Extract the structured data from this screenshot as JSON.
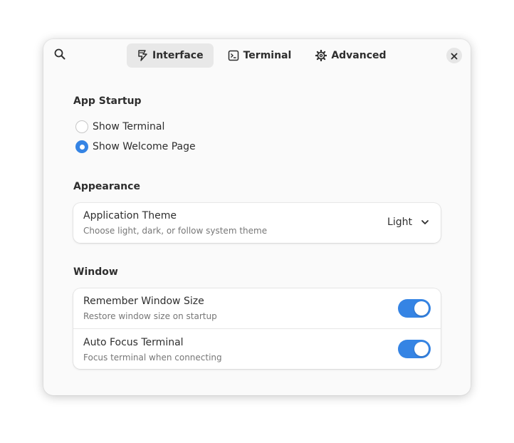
{
  "header": {
    "search_icon": "search-icon",
    "close_icon": "close-icon",
    "tabs": [
      {
        "label": "Interface",
        "icon": "brush-icon",
        "active": true
      },
      {
        "label": "Terminal",
        "icon": "terminal-icon",
        "active": false
      },
      {
        "label": "Advanced",
        "icon": "gear-icon",
        "active": false
      }
    ]
  },
  "startup": {
    "title": "App Startup",
    "options": [
      {
        "label": "Show Terminal",
        "checked": false
      },
      {
        "label": "Show Welcome Page",
        "checked": true
      }
    ]
  },
  "appearance": {
    "title": "Appearance",
    "theme": {
      "title": "Application Theme",
      "subtitle": "Choose light, dark, or follow system theme",
      "value": "Light"
    }
  },
  "window": {
    "title": "Window",
    "rows": [
      {
        "title": "Remember Window Size",
        "subtitle": "Restore window size on startup",
        "enabled": true
      },
      {
        "title": "Auto Focus Terminal",
        "subtitle": "Focus terminal when connecting",
        "enabled": true
      }
    ]
  },
  "colors": {
    "accent": "#3584e4",
    "window_bg": "#fafafa",
    "card_bg": "#ffffff"
  }
}
